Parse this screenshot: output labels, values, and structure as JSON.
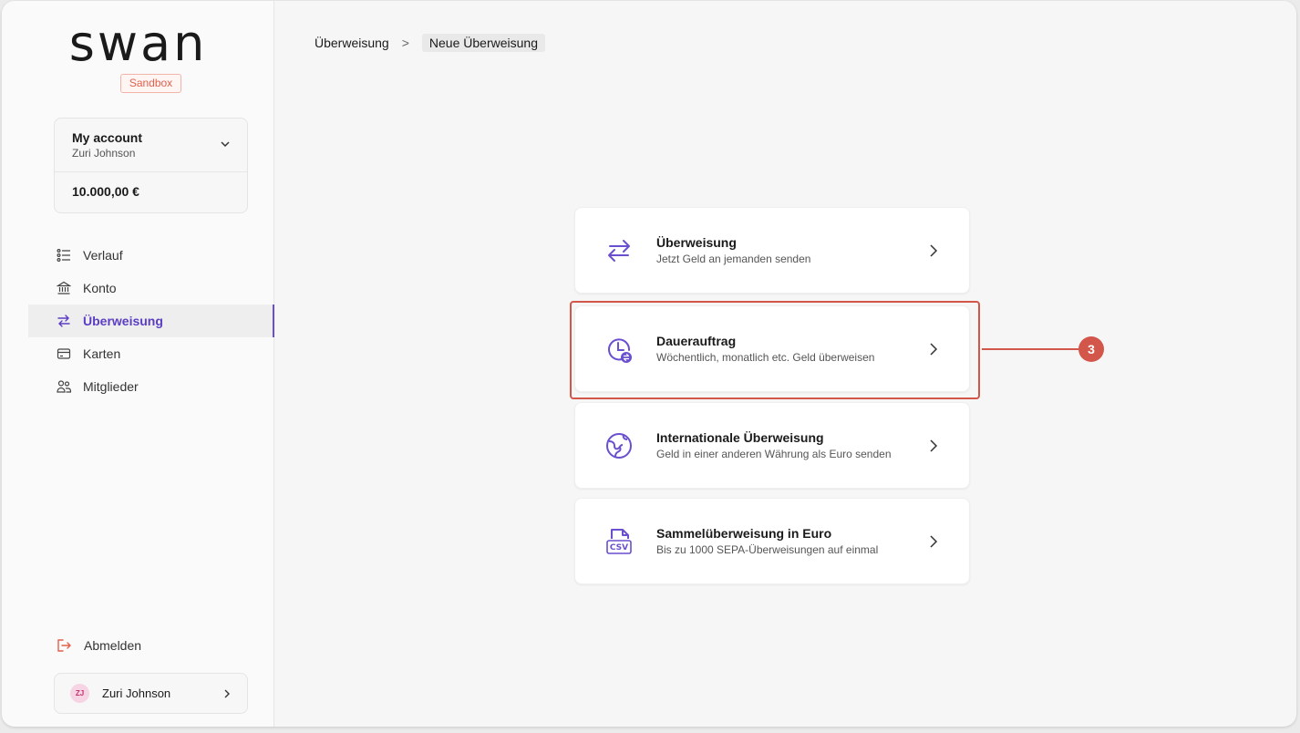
{
  "brand": {
    "logo": "swan",
    "env_badge": "Sandbox"
  },
  "account": {
    "title": "My account",
    "owner": "Zuri Johnson",
    "balance": "10.000,00 €"
  },
  "nav": {
    "items": [
      {
        "label": "Verlauf",
        "icon": "list-icon"
      },
      {
        "label": "Konto",
        "icon": "bank-icon"
      },
      {
        "label": "Überweisung",
        "icon": "transfer-icon",
        "active": true
      },
      {
        "label": "Karten",
        "icon": "card-icon"
      },
      {
        "label": "Mitglieder",
        "icon": "members-icon"
      }
    ]
  },
  "footer": {
    "logout_label": "Abmelden",
    "user_initials": "ZJ",
    "user_name": "Zuri Johnson"
  },
  "breadcrumb": {
    "parent": "Überweisung",
    "separator": ">",
    "current": "Neue Überweisung"
  },
  "options": [
    {
      "title": "Überweisung",
      "subtitle": "Jetzt Geld an jemanden senden",
      "icon": "transfer-icon"
    },
    {
      "title": "Dauerauftrag",
      "subtitle": "Wöchentlich, monatlich etc. Geld überweisen",
      "icon": "recurring-clock-icon"
    },
    {
      "title": "Internationale Überweisung",
      "subtitle": "Geld in einer anderen Währung als Euro senden",
      "icon": "globe-icon"
    },
    {
      "title": "Sammelüberweisung in Euro",
      "subtitle": "Bis zu 1000 SEPA-Überweisungen auf einmal",
      "icon": "csv-file-icon"
    }
  ],
  "annotation": {
    "step": "3"
  },
  "colors": {
    "accent": "#6a4fd1",
    "highlight": "#d2574a",
    "sandbox": "#e2614c"
  }
}
